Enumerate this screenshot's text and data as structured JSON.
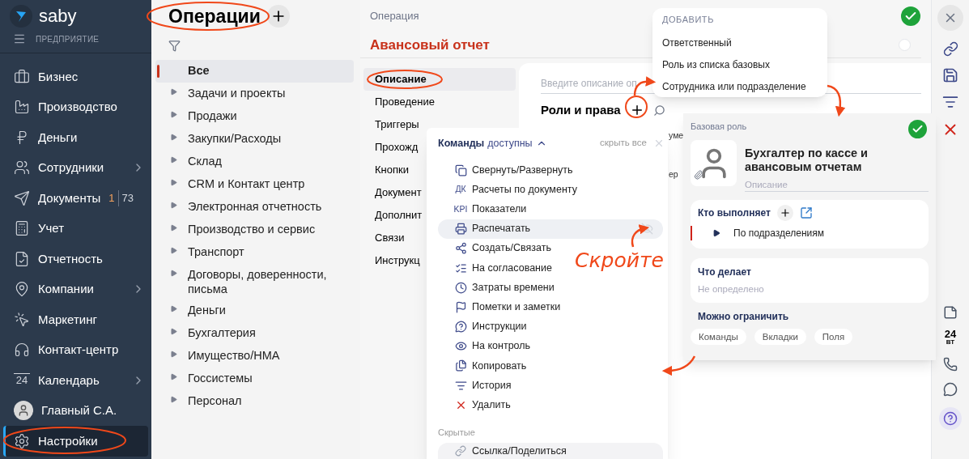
{
  "sidebar": {
    "logo": "saby",
    "section": "ПРЕДПРИЯТИЕ",
    "items": [
      {
        "label": "Бизнес",
        "has_submenu": false,
        "selected": false
      },
      {
        "label": "Производство",
        "has_submenu": false,
        "selected": false
      },
      {
        "label": "Деньги",
        "has_submenu": false,
        "selected": false
      },
      {
        "label": "Сотрудники",
        "has_submenu": true,
        "selected": false
      },
      {
        "label": "Документы",
        "has_submenu": false,
        "selected": false,
        "counter_new": "1",
        "counter_total": "73"
      },
      {
        "label": "Учет",
        "has_submenu": false,
        "selected": false
      },
      {
        "label": "Отчетность",
        "has_submenu": false,
        "selected": false
      },
      {
        "label": "Компании",
        "has_submenu": true,
        "selected": false
      },
      {
        "label": "Маркетинг",
        "has_submenu": false,
        "selected": false
      },
      {
        "label": "Контакт-центр",
        "has_submenu": false,
        "selected": false
      },
      {
        "label": "Календарь",
        "has_submenu": true,
        "selected": false,
        "icon_text": "24"
      },
      {
        "label": "Главный С.А.",
        "has_submenu": false,
        "selected": false
      },
      {
        "label": "Настройки",
        "has_submenu": false,
        "selected": true
      }
    ]
  },
  "operations": {
    "title": "Операции",
    "categories": [
      {
        "label": "Все",
        "expandable": false,
        "selected": true
      },
      {
        "label": "Задачи и проекты",
        "expandable": true,
        "selected": false
      },
      {
        "label": "Продажи",
        "expandable": true,
        "selected": false
      },
      {
        "label": "Закупки/Расходы",
        "expandable": true,
        "selected": false
      },
      {
        "label": "Склад",
        "expandable": true,
        "selected": false
      },
      {
        "label": "CRM и Контакт центр",
        "expandable": true,
        "selected": false
      },
      {
        "label": "Электронная отчетность",
        "expandable": true,
        "selected": false
      },
      {
        "label": "Производство и сервис",
        "expandable": true,
        "selected": false
      },
      {
        "label": "Транспорт",
        "expandable": true,
        "selected": false
      },
      {
        "label": "Договоры, доверенности, письма",
        "expandable": true,
        "selected": false
      },
      {
        "label": "Деньги",
        "expandable": true,
        "selected": false
      },
      {
        "label": "Бухгалтерия",
        "expandable": true,
        "selected": false
      },
      {
        "label": "Имущество/НМА",
        "expandable": true,
        "selected": false
      },
      {
        "label": "Госсистемы",
        "expandable": true,
        "selected": false
      },
      {
        "label": "Персонал",
        "expandable": true,
        "selected": false
      }
    ]
  },
  "main": {
    "header": "Операция",
    "title": "Авансовый отчет",
    "tabs": [
      {
        "label": "Описание",
        "selected": true
      },
      {
        "label": "Проведение",
        "selected": false
      },
      {
        "label": "Триггеры",
        "selected": false
      },
      {
        "label": "Прохожд",
        "selected": false
      },
      {
        "label": "Кнопки",
        "selected": false
      },
      {
        "label": "Документ",
        "selected": false
      },
      {
        "label": "Дополнит",
        "selected": false
      },
      {
        "label": "Связи",
        "selected": false
      },
      {
        "label": "Инструкц",
        "selected": false
      }
    ],
    "description_placeholder": "Введите описание оп",
    "roles_title": "Роли и права",
    "roles_fragments": [
      "уме",
      "ер"
    ]
  },
  "add_menu": {
    "title": "ДОБАВИТЬ",
    "items": [
      "Ответственный",
      "Роль из списка базовых",
      "Сотрудника или подразделение"
    ]
  },
  "commands_popup": {
    "title": "Команды",
    "filter": "доступны",
    "hide_all": "скрыть все",
    "items": [
      {
        "label": "Свернуть/Развернуть",
        "hovered": false
      },
      {
        "label": "Расчеты по документу",
        "hovered": false,
        "icon_text": "ДК"
      },
      {
        "label": "Показатели",
        "hovered": false,
        "icon_text": "KPI"
      },
      {
        "label": "Распечатать",
        "hovered": true
      },
      {
        "label": "Создать/Связать",
        "hovered": false
      },
      {
        "label": "На согласование",
        "hovered": false
      },
      {
        "label": "Затраты времени",
        "hovered": false
      },
      {
        "label": "Пометки и заметки",
        "hovered": false
      },
      {
        "label": "Инструкции",
        "hovered": false
      },
      {
        "label": "На контроль",
        "hovered": false
      },
      {
        "label": "Копировать",
        "hovered": false
      },
      {
        "label": "История",
        "hovered": false
      },
      {
        "label": "Удалить",
        "hovered": false
      }
    ],
    "hidden_title": "Скрытые",
    "hidden_items": [
      "Ссылка/Поделиться"
    ]
  },
  "role_card": {
    "label": "Базовая роль",
    "name": "Бухгалтер по кассе и авансовым отчетам",
    "description_placeholder": "Описание",
    "performers_title": "Кто выполняет",
    "performers": [
      {
        "label": "По подразделениям",
        "selected": true
      }
    ],
    "does_title": "Что делает",
    "does_value": "Не определено",
    "restrict_title": "Можно ограничить",
    "restrict_chips": [
      "Команды",
      "Вкладки",
      "Поля"
    ]
  },
  "annotation": "Скройте",
  "right_toolbar": {
    "calendar_day": "24",
    "calendar_weekday": "ВТ"
  }
}
